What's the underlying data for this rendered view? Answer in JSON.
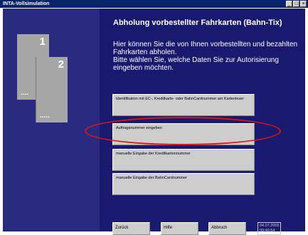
{
  "window": {
    "title": "INTA-Vollsimulation",
    "buttons": [
      "_",
      "□",
      "×"
    ]
  },
  "cards": [
    {
      "number": "1",
      "dots": "...."
    },
    {
      "number": "2",
      "dots": "....."
    }
  ],
  "main": {
    "heading": "Abholung vorbestellter Fahrkarten (Bahn-Tix)",
    "info_line1": "Hier können Sie die von Ihnen vorbestellten und bezahlten Fahrkarten abholen.",
    "info_line2": "Bitte wählen Sie, welche Daten Sie zur Autorisierung eingeben möchten."
  },
  "options": [
    {
      "label": "Identifikation mit EC-, Kreditkarte- oder BahnCardnummer am Kartenleser"
    },
    {
      "label": "Auftragsnummer eingeben"
    },
    {
      "label": "manuelle Eingabe der Kreditkartennummer"
    },
    {
      "label": "manuelle Eingabe der BahnCardnummer"
    }
  ],
  "bottom": {
    "back": "Zurück",
    "help": "Hilfe",
    "cancel": "Abbruch",
    "date": "04.07.2005",
    "time": "09:46:54"
  },
  "colors": {
    "background": "#191970",
    "left_panel": "#2a2a7f",
    "button": "#cdcdcd",
    "highlight": "#e01414"
  }
}
